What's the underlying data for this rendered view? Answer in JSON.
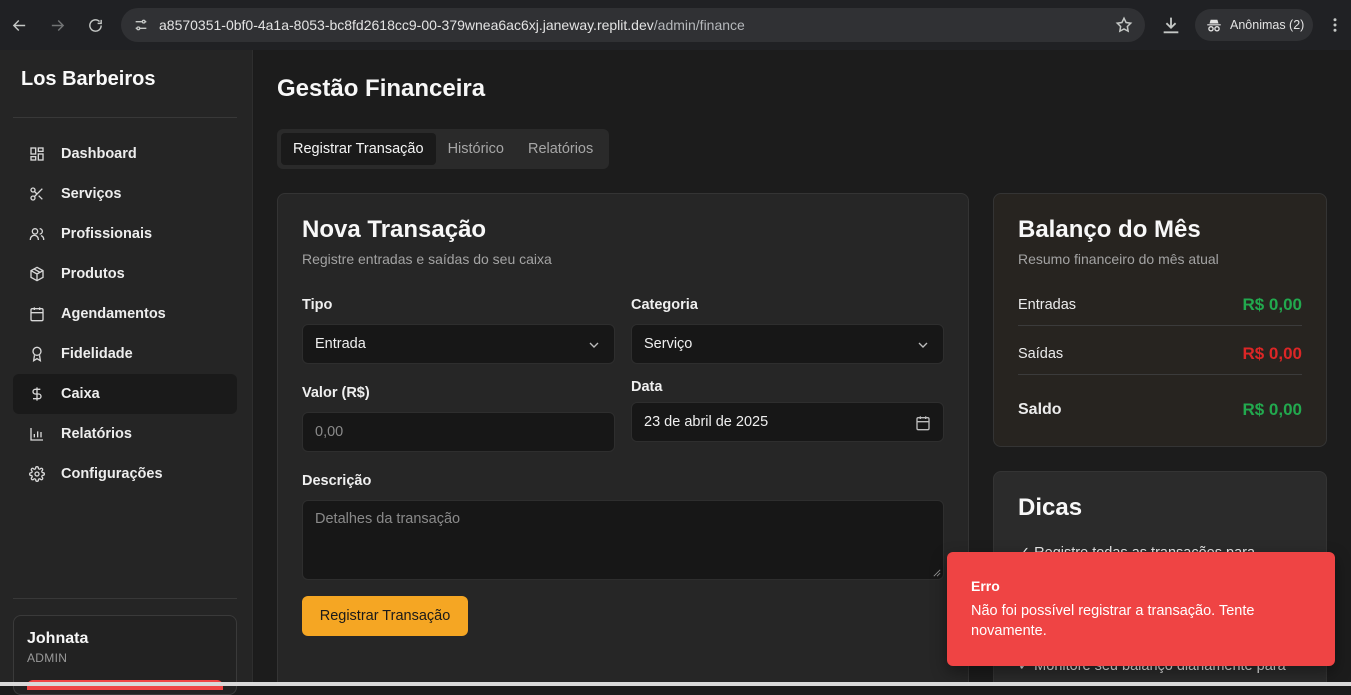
{
  "browser": {
    "url_host": "a8570351-0bf0-4a1a-8053-bc8fd2618cc9-00-379wnea6ac6xj.janeway.replit.dev",
    "url_path": "/admin/finance",
    "profile_label": "Anônimas (2)"
  },
  "sidebar": {
    "brand": "Los Barbeiros",
    "items": [
      {
        "label": "Dashboard",
        "icon": "layout-grid-icon"
      },
      {
        "label": "Serviços",
        "icon": "scissors-icon"
      },
      {
        "label": "Profissionais",
        "icon": "users-icon"
      },
      {
        "label": "Produtos",
        "icon": "package-icon"
      },
      {
        "label": "Agendamentos",
        "icon": "calendar-icon"
      },
      {
        "label": "Fidelidade",
        "icon": "award-icon"
      },
      {
        "label": "Caixa",
        "icon": "dollar-icon",
        "active": true
      },
      {
        "label": "Relatórios",
        "icon": "bar-chart-icon"
      },
      {
        "label": "Configurações",
        "icon": "gear-icon"
      }
    ],
    "user": {
      "name": "Johnata",
      "role": "ADMIN"
    }
  },
  "main": {
    "title": "Gestão Financeira",
    "tabs": [
      "Registrar Transação",
      "Histórico",
      "Relatórios"
    ],
    "active_tab": "Registrar Transação"
  },
  "form": {
    "title": "Nova Transação",
    "subtitle": "Registre entradas e saídas do seu caixa",
    "tipo_label": "Tipo",
    "tipo_value": "Entrada",
    "categoria_label": "Categoria",
    "categoria_value": "Serviço",
    "valor_label": "Valor (R$)",
    "valor_placeholder": "0,00",
    "data_label": "Data",
    "data_value": "23 de abril de 2025",
    "descricao_label": "Descrição",
    "descricao_placeholder": "Detalhes da transação",
    "submit_label": "Registrar Transação"
  },
  "balance": {
    "title": "Balanço do Mês",
    "subtitle": "Resumo financeiro do mês atual",
    "entradas_label": "Entradas",
    "entradas_value": "R$ 0,00",
    "saidas_label": "Saídas",
    "saidas_value": "R$ 0,00",
    "saldo_label": "Saldo",
    "saldo_value": "R$ 0,00",
    "colors": {
      "positive": "#22a94e",
      "negative": "#dc2626"
    }
  },
  "tips": {
    "title": "Dicas",
    "line1": "✓ Registre todas as transações para",
    "line2": "✓ Monitore seu balanço diariamente para"
  },
  "toast": {
    "title": "Erro",
    "description": "Não foi possível registrar a transação. Tente novamente.",
    "color": "#ef4444"
  },
  "accent": "#f5a623"
}
